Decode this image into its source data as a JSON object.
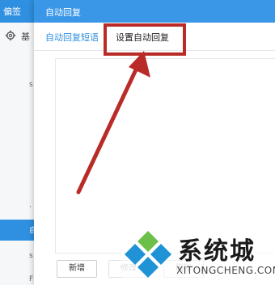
{
  "background_window": {
    "title": "偏签",
    "fragments": [
      "基",
      "s",
      "·",
      "自",
      "s",
      "F"
    ]
  },
  "dialog": {
    "title": "自动回复",
    "tabs": [
      {
        "label": "自动回复短语",
        "active": true
      },
      {
        "label": "设置自动回复",
        "active": false
      }
    ],
    "buttons": {
      "add": "新增",
      "edit": "修改",
      "delete": "删除"
    }
  },
  "annotation": {
    "color": "#b92b27"
  },
  "watermark": {
    "brand": "系统城",
    "url": "XITONGCHENG.COM"
  },
  "colors": {
    "accent": "#3a97e8",
    "title_bar": "#2f8fe0",
    "annotation": "#b92b27"
  }
}
